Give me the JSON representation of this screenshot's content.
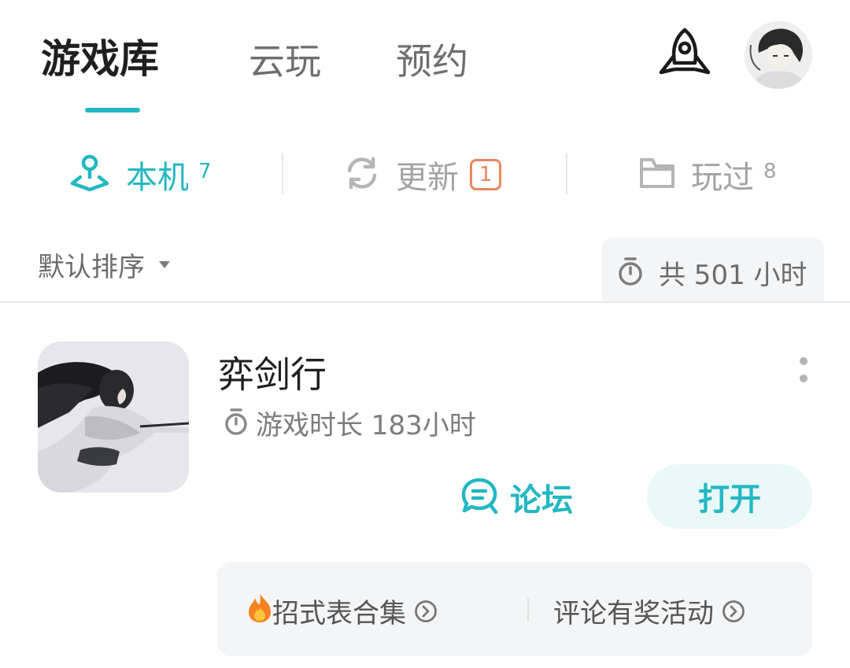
{
  "top_tabs": [
    {
      "label": "游戏库",
      "active": true
    },
    {
      "label": "云玩",
      "active": false
    },
    {
      "label": "预约",
      "active": false
    }
  ],
  "sub_tabs": [
    {
      "label": "本机",
      "count": "7",
      "icon": "joystick-icon",
      "active": true
    },
    {
      "label": "更新",
      "badge": "1",
      "icon": "refresh-icon",
      "active": false
    },
    {
      "label": "玩过",
      "count": "8",
      "icon": "folder-icon",
      "active": false
    }
  ],
  "sort": {
    "label": "默认排序"
  },
  "total_playtime": "共 501 小时",
  "game": {
    "title": "弈剑行",
    "playtime": "游戏时长 183小时",
    "forum_label": "论坛",
    "open_label": "打开"
  },
  "activities": [
    {
      "emoji": "🔥",
      "label": "招式表合集"
    },
    {
      "label": "评论有奖活动"
    }
  ],
  "colors": {
    "accent": "#22b8c2",
    "badge": "#e8875f",
    "inactive_text": "#a3a3a3"
  }
}
